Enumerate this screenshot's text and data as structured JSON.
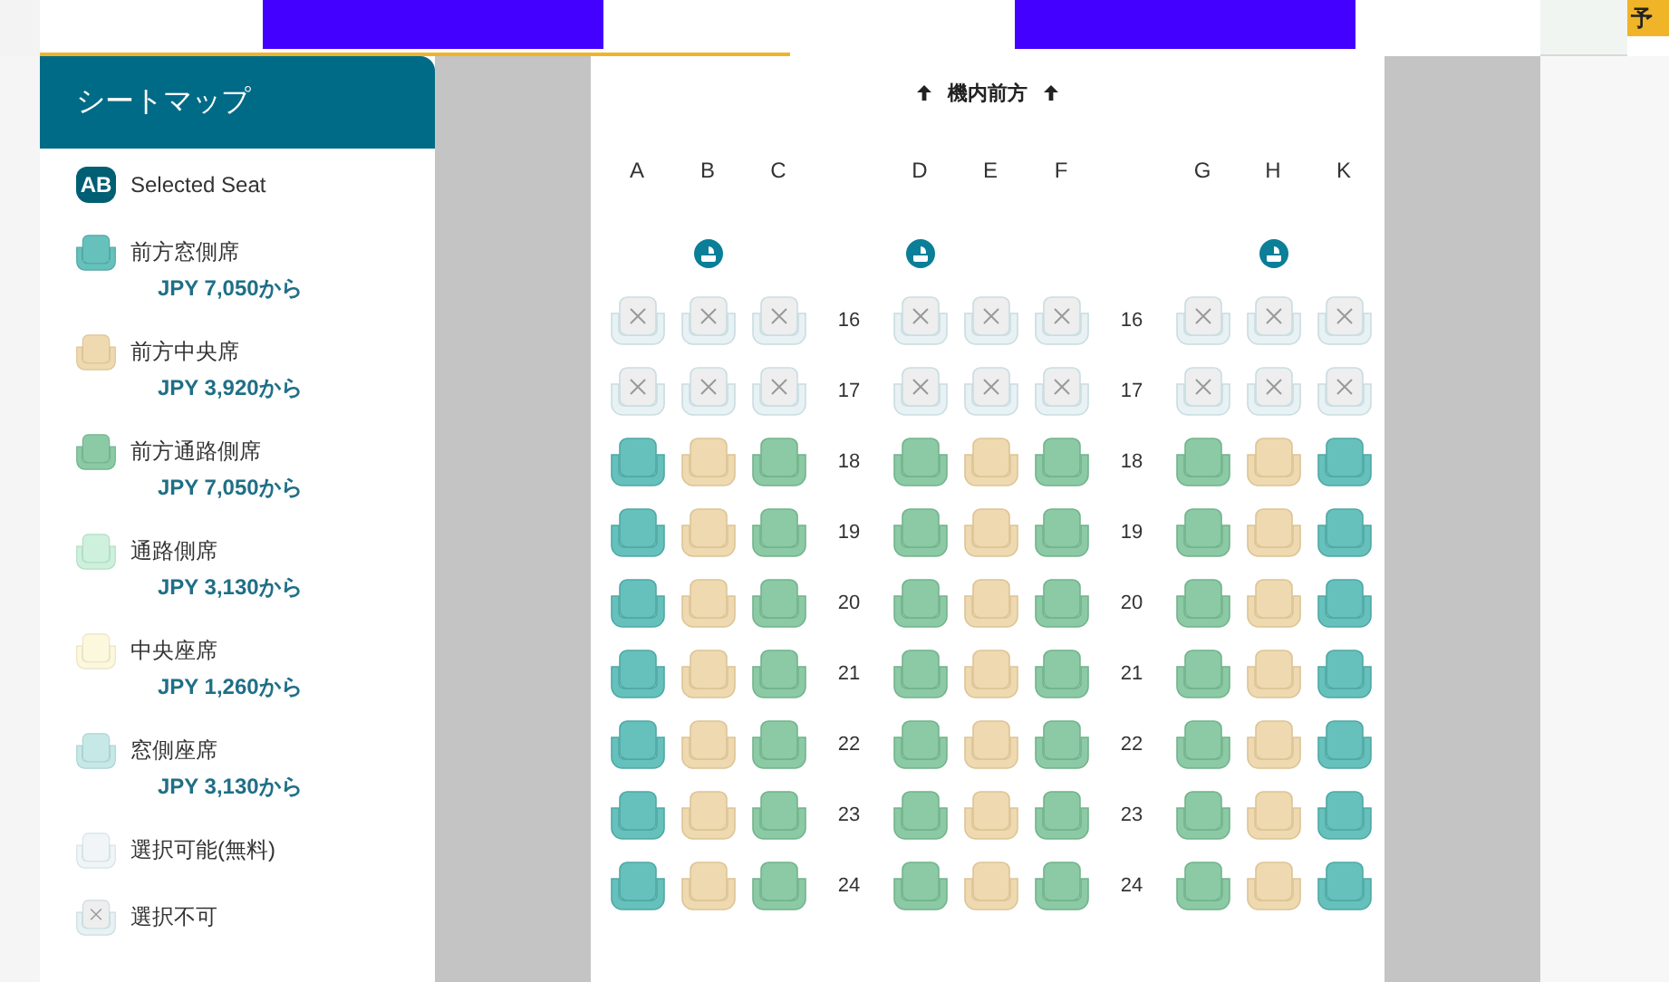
{
  "top_bar": {
    "corner_button": "予"
  },
  "sidebar": {
    "title": "シートマップ",
    "legend": [
      {
        "kind": "selected",
        "label": "Selected Seat",
        "icon_text": "AB"
      },
      {
        "kind": "front_window",
        "label": "前方窓側席",
        "price": "JPY 7,050から"
      },
      {
        "kind": "front_middle",
        "label": "前方中央席",
        "price": "JPY 3,920から"
      },
      {
        "kind": "front_aisle",
        "label": "前方通路側席",
        "price": "JPY 7,050から"
      },
      {
        "kind": "aisle",
        "label": "通路側席",
        "price": "JPY 3,130から"
      },
      {
        "kind": "middle",
        "label": "中央座席",
        "price": "JPY 1,260から"
      },
      {
        "kind": "window",
        "label": "窓側座席",
        "price": "JPY 3,130から"
      },
      {
        "kind": "free",
        "label": "選択可能(無料)"
      },
      {
        "kind": "unavailable",
        "label": "選択不可"
      }
    ]
  },
  "seat_map": {
    "heading": "機内前方",
    "columns": [
      {
        "letter": "A",
        "kind": "plain"
      },
      {
        "letter": "B",
        "kind": "lavatory"
      },
      {
        "letter": "C",
        "kind": "plain"
      },
      {
        "letter": "D",
        "kind": "lavatory"
      },
      {
        "letter": "E",
        "kind": "plain"
      },
      {
        "letter": "F",
        "kind": "plain"
      },
      {
        "letter": "G",
        "kind": "plain"
      },
      {
        "letter": "H",
        "kind": "lavatory"
      },
      {
        "letter": "K",
        "kind": "plain"
      }
    ],
    "rows": [
      {
        "numbers": [
          "16",
          "16"
        ],
        "seats": [
          {
            "kind": "unavailable"
          },
          {
            "kind": "unavailable"
          },
          {
            "kind": "unavailable"
          },
          {
            "kind": "unavailable"
          },
          {
            "kind": "unavailable"
          },
          {
            "kind": "unavailable"
          },
          {
            "kind": "unavailable"
          },
          {
            "kind": "unavailable"
          },
          {
            "kind": "unavailable"
          }
        ]
      },
      {
        "numbers": [
          "17",
          "17"
        ],
        "seats": [
          {
            "kind": "unavailable"
          },
          {
            "kind": "unavailable"
          },
          {
            "kind": "unavailable"
          },
          {
            "kind": "unavailable"
          },
          {
            "kind": "unavailable"
          },
          {
            "kind": "unavailable"
          },
          {
            "kind": "unavailable"
          },
          {
            "kind": "unavailable"
          },
          {
            "kind": "unavailable"
          }
        ]
      },
      {
        "numbers": [
          "18",
          "18"
        ],
        "seats": [
          {
            "kind": "front_window"
          },
          {
            "kind": "front_middle"
          },
          {
            "kind": "front_aisle"
          },
          {
            "kind": "front_aisle"
          },
          {
            "kind": "front_middle"
          },
          {
            "kind": "front_aisle"
          },
          {
            "kind": "front_aisle"
          },
          {
            "kind": "front_middle"
          },
          {
            "kind": "front_window"
          }
        ]
      },
      {
        "numbers": [
          "19",
          "19"
        ],
        "seats": [
          {
            "kind": "front_window"
          },
          {
            "kind": "front_middle"
          },
          {
            "kind": "front_aisle"
          },
          {
            "kind": "front_aisle"
          },
          {
            "kind": "front_middle"
          },
          {
            "kind": "front_aisle"
          },
          {
            "kind": "front_aisle"
          },
          {
            "kind": "front_middle"
          },
          {
            "kind": "front_window"
          }
        ]
      },
      {
        "numbers": [
          "20",
          "20"
        ],
        "seats": [
          {
            "kind": "front_window"
          },
          {
            "kind": "front_middle"
          },
          {
            "kind": "front_aisle"
          },
          {
            "kind": "front_aisle"
          },
          {
            "kind": "front_middle"
          },
          {
            "kind": "front_aisle"
          },
          {
            "kind": "front_aisle"
          },
          {
            "kind": "front_middle"
          },
          {
            "kind": "front_window"
          }
        ]
      },
      {
        "numbers": [
          "21",
          "21"
        ],
        "seats": [
          {
            "kind": "front_window"
          },
          {
            "kind": "front_middle"
          },
          {
            "kind": "front_aisle"
          },
          {
            "kind": "front_aisle"
          },
          {
            "kind": "front_middle"
          },
          {
            "kind": "front_aisle"
          },
          {
            "kind": "front_aisle"
          },
          {
            "kind": "front_middle"
          },
          {
            "kind": "front_window"
          }
        ]
      },
      {
        "numbers": [
          "22",
          "22"
        ],
        "seats": [
          {
            "kind": "front_window"
          },
          {
            "kind": "front_middle"
          },
          {
            "kind": "front_aisle"
          },
          {
            "kind": "front_aisle"
          },
          {
            "kind": "front_middle"
          },
          {
            "kind": "front_aisle"
          },
          {
            "kind": "front_aisle"
          },
          {
            "kind": "front_middle"
          },
          {
            "kind": "front_window"
          }
        ]
      },
      {
        "numbers": [
          "23",
          "23"
        ],
        "seats": [
          {
            "kind": "front_window"
          },
          {
            "kind": "front_middle"
          },
          {
            "kind": "front_aisle"
          },
          {
            "kind": "front_aisle"
          },
          {
            "kind": "front_middle"
          },
          {
            "kind": "front_aisle"
          },
          {
            "kind": "front_aisle"
          },
          {
            "kind": "front_middle"
          },
          {
            "kind": "front_window"
          }
        ]
      },
      {
        "numbers": [
          "24",
          "24"
        ],
        "seats": [
          {
            "kind": "front_window"
          },
          {
            "kind": "front_middle"
          },
          {
            "kind": "front_aisle"
          },
          {
            "kind": "front_aisle"
          },
          {
            "kind": "front_middle"
          },
          {
            "kind": "front_aisle"
          },
          {
            "kind": "front_aisle"
          },
          {
            "kind": "front_middle"
          },
          {
            "kind": "front_window"
          }
        ]
      }
    ]
  }
}
